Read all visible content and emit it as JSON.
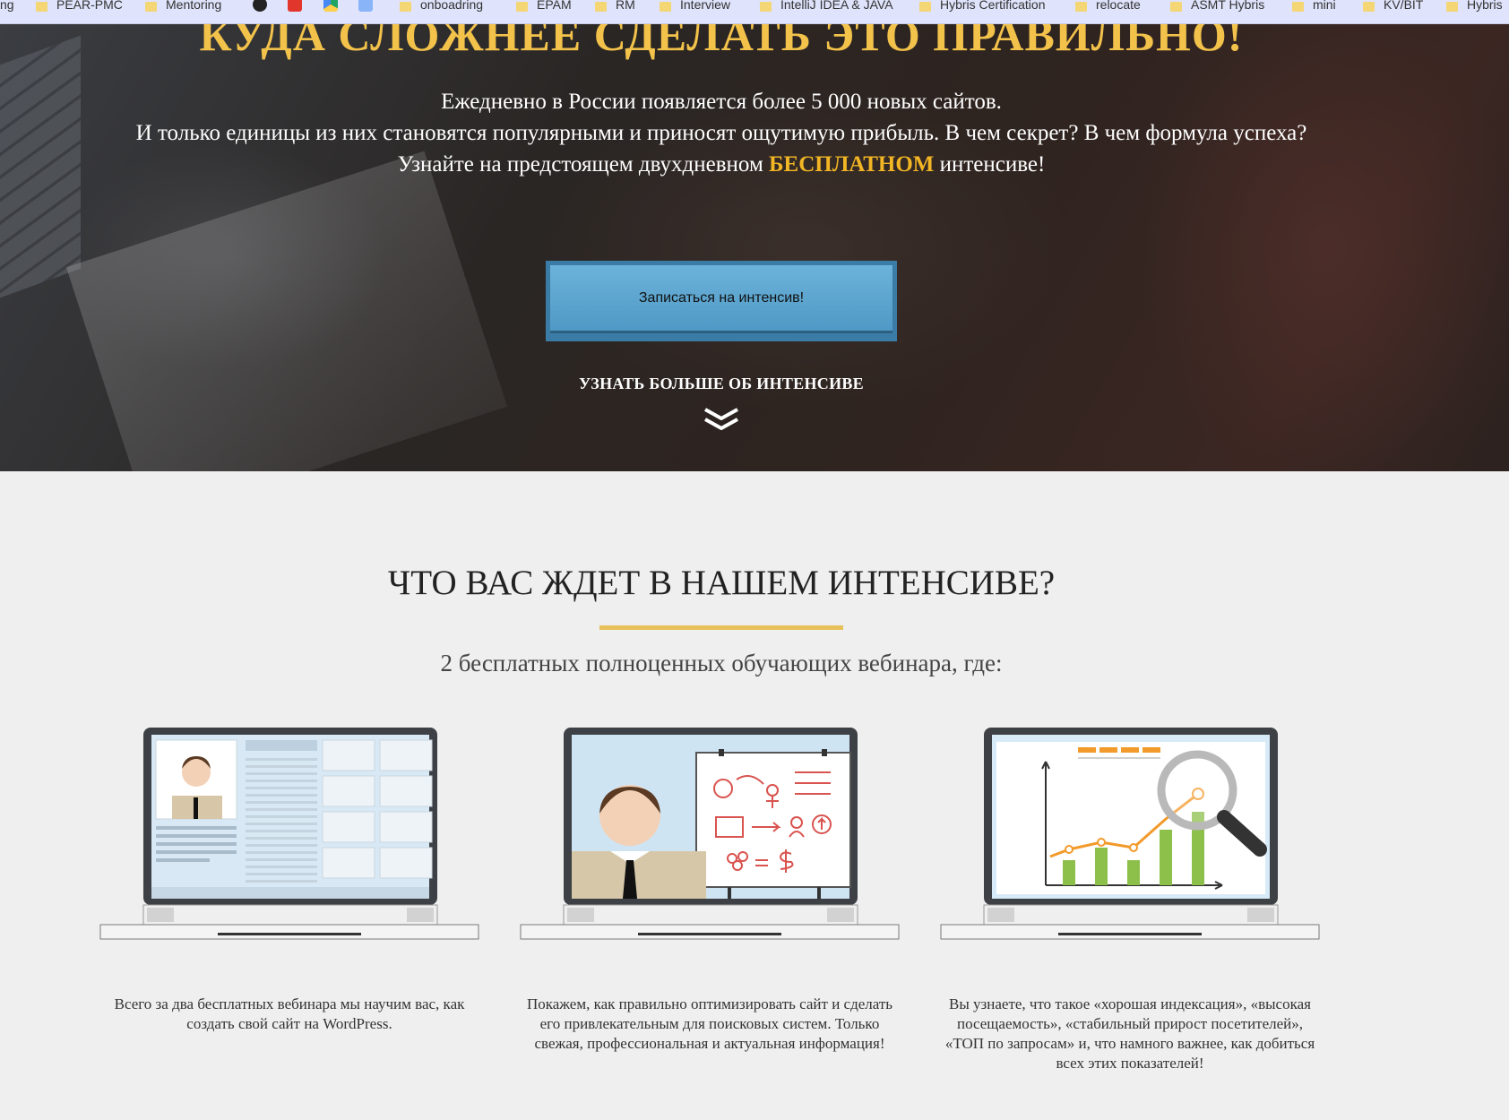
{
  "bookmarks": [
    {
      "label": "ng",
      "type": "text"
    },
    {
      "label": "PEAR-PMC",
      "type": "folder"
    },
    {
      "label": "Mentoring",
      "type": "folder"
    },
    {
      "label": "",
      "type": "app",
      "icon": "app-icon-dark"
    },
    {
      "label": "",
      "type": "app",
      "icon": "app-icon-red"
    },
    {
      "label": "",
      "type": "app",
      "icon": "google-drive-icon"
    },
    {
      "label": "",
      "type": "app",
      "icon": "app-icon-blue"
    },
    {
      "label": "onboadring",
      "type": "folder"
    },
    {
      "label": "EPAM",
      "type": "folder"
    },
    {
      "label": "RM",
      "type": "folder"
    },
    {
      "label": "Interview",
      "type": "folder"
    },
    {
      "label": "IntelliJ IDEA & JAVA",
      "type": "folder"
    },
    {
      "label": "Hybris Certification",
      "type": "folder"
    },
    {
      "label": "relocate",
      "type": "folder"
    },
    {
      "label": "ASMT Hybris",
      "type": "folder"
    },
    {
      "label": "mini",
      "type": "folder"
    },
    {
      "label": "KV/BIT",
      "type": "folder"
    },
    {
      "label": "Hybris",
      "type": "folder"
    }
  ],
  "hero": {
    "title": "КУДА СЛОЖНЕЕ СДЕЛАТЬ ЭТО ПРАВИЛЬНО!",
    "line1": "Ежедневно в России появляется более 5 000 новых сайтов.",
    "line2": "И только единицы из них становятся популярными и приносят ощутимую прибыль. В чем секрет? В чем формула успеха?",
    "line3_before": "Узнайте на предстоящем двухдневном ",
    "line3_highlight": "БЕСПЛАТНОМ",
    "line3_after": " интенсиве!",
    "cta_label": "Записаться на интенсив!",
    "more_label": "УЗНАТЬ БОЛЬШЕ ОБ ИНТЕНСИВЕ",
    "more_icon": "double-chevron-down-icon"
  },
  "section": {
    "title": "ЧТО ВАС ЖДЕТ В НАШЕМ ИНТЕНСИВЕ?",
    "subtitle": "2 бесплатных полноценных обучающих вебинара, где:",
    "features": [
      {
        "icon": "laptop-profile-illustration",
        "text": "Всего за два бесплатных вебинара мы научим вас, как создать свой сайт на WordPress."
      },
      {
        "icon": "laptop-presenter-illustration",
        "text": "Покажем, как правильно оптимизировать сайт и сделать его привлекательным для поисковых систем. Только свежая, профессиональная и актуальная информация!"
      },
      {
        "icon": "laptop-analytics-illustration",
        "text": "Вы узнаете, что такое «хорошая индексация», «высокая посещаемость», «стабильный прирост посетителей», «ТОП по запросам» и, что намного важнее, как добиться всех этих показателей!"
      }
    ]
  },
  "colors": {
    "accent_gold": "#f2c24b",
    "highlight": "#f2b624",
    "button": "#5aa6d0",
    "underline": "#e7c05a",
    "background": "#efefef"
  }
}
